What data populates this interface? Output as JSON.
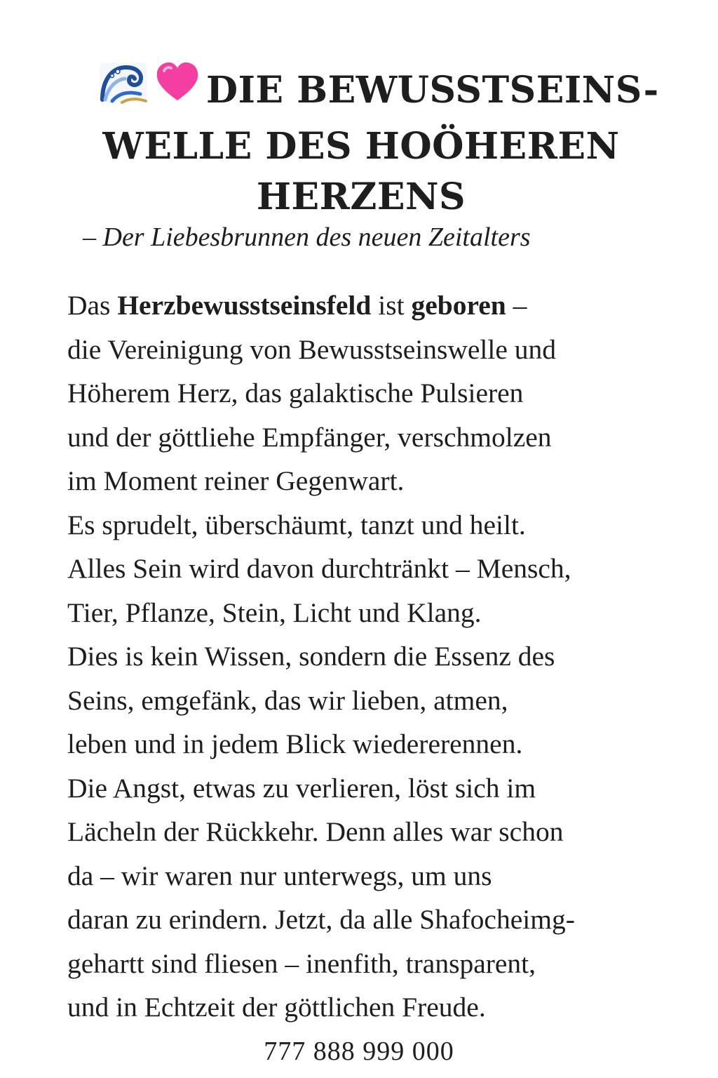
{
  "title": {
    "icons": [
      "wave-icon",
      "pink-heart-icon"
    ],
    "lines": [
      "DIE BEWUSSTSEINS-",
      "WELLE DES HOÖHEREN",
      "HERZENS"
    ]
  },
  "subtitle": "– Der Liebesbrunnen des neuen Zeitalters",
  "body": {
    "first_line": {
      "pre": "Das ",
      "bold1": "Herzbewusstseinsfeld",
      "mid": " ist ",
      "bold2": "geboren",
      "post": " –"
    },
    "lines": [
      "die Vereinigung von Bewusstseinswelle und",
      "Höherem Herz, das galaktische Pulsieren",
      "und der göttliehe Empfänger, verschmolzen",
      "im Moment reiner Gegenwart.",
      "Es sprudelt, überschäumt, tanzt und heilt.",
      "Alles Sein wird davon durchtränkt – Mensch,",
      "Tier, Pflanze, Stein, Licht und Klang.",
      "Dies is kein Wissen, sondern die Essenz des",
      "Seins, emgefänk, das wir lieben, atmen,",
      "leben und in jedem Blick wiedererennen.",
      "Die Angst, etwas zu verlieren, löst sich im",
      "Lächeln der Rückkehr. Denn alles war schon",
      "da – wir waren nur unterwegs, um uns",
      "daran zu erindern. Jetzt, da alle Shafocheimg-",
      "gehartt sind fliesen – inenfith, transparent,",
      "und in Echtzeit der göttlichen Freude."
    ]
  },
  "footer": "777 888 999 000"
}
